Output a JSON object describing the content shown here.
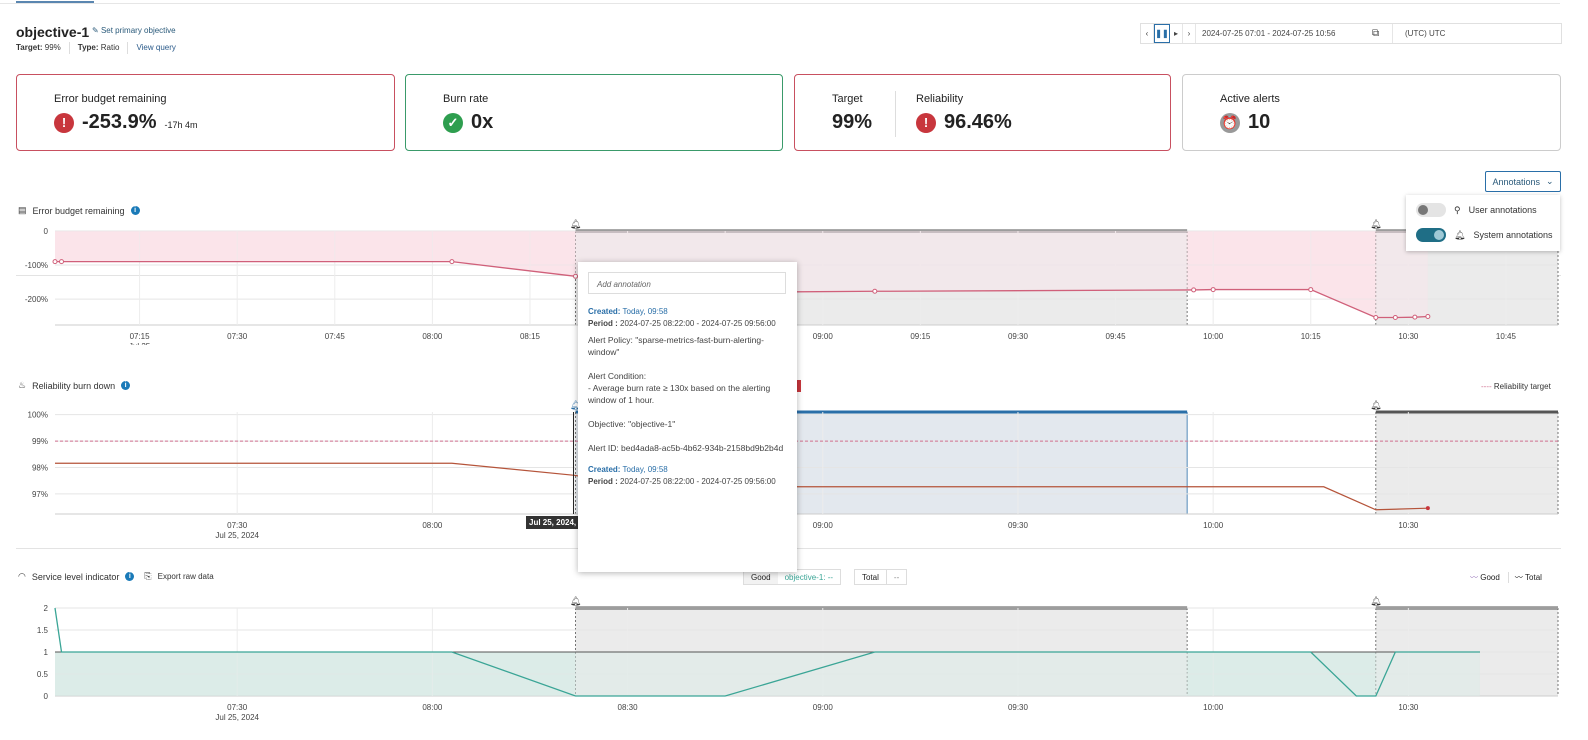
{
  "header": {
    "title": "objective-1",
    "set_primary": "Set primary objective",
    "target_label": "Target:",
    "target_value": "99%",
    "type_label": "Type:",
    "type_value": "Ratio",
    "view_query": "View query"
  },
  "timebar": {
    "range": "2024-07-25 07:01 - 2024-07-25 10:56",
    "timezone": "(UTC) UTC"
  },
  "cards": {
    "error_budget": {
      "label": "Error budget remaining",
      "value": "-253.9%",
      "sub": "-17h 4m",
      "icon": "error-icon"
    },
    "burn_rate": {
      "label": "Burn rate",
      "value": "0x",
      "icon": "check-badge-icon"
    },
    "target": {
      "label": "Target",
      "value": "99%"
    },
    "reliability": {
      "label": "Reliability",
      "value": "96.46%",
      "icon": "error-icon"
    },
    "alerts": {
      "label": "Active alerts",
      "value": "10",
      "icon": "alarm-icon"
    }
  },
  "annotations": {
    "button": "Annotations",
    "user": "User annotations",
    "user_on": false,
    "system": "System annotations",
    "system_on": true
  },
  "sections": {
    "ebr": "Error budget remaining",
    "rbd": "Reliability burn down",
    "rbd_legend": "Reliability target",
    "sli": "Service level indicator",
    "export": "Export raw data",
    "good": "Good",
    "good_val": "objective-1: --",
    "total": "Total",
    "total_val": "--",
    "legend_good": "Good",
    "legend_total": "Total"
  },
  "crosshair_label": "Jul 25, 2024,",
  "popup": {
    "placeholder": "Add annotation",
    "created_label": "Created:",
    "created": "Today, 09:58",
    "period_label": "Period :",
    "period": "2024-07-25 08:22:00 - 2024-07-25 09:56:00",
    "policy": "Alert Policy: \"sparse-metrics-fast-burn-alerting-window\"",
    "condition_title": "Alert Condition:",
    "condition": " - Average burn rate ≥ 130x based on the alerting window of 1 hour.",
    "objective": "Objective: \"objective-1\"",
    "alert_id": "Alert ID: bed4ada8-ac5b-4b62-934b-2158bd9b2b4d"
  },
  "colors": {
    "error": "#c8363d",
    "ok": "#2e9e4f",
    "ebr_line": "#d0607a",
    "ebr_fill": "#fbe4ea",
    "rel_line": "#b5543a",
    "target_line": "#d07090",
    "sli_line": "#3aa596",
    "sli_fill": "#dcece8",
    "alert_fill": "#d9d9d9",
    "selected": "#2a6fa8"
  },
  "chart_data": [
    {
      "type": "line",
      "title": "Error budget remaining",
      "y_ticks": [
        "0",
        "-100%",
        "-200%"
      ],
      "ylim": [
        -276,
        0
      ],
      "x_ticks": [
        "07:15",
        "07:30",
        "07:45",
        "08:00",
        "08:15",
        "08:30",
        "08:45",
        "09:00",
        "09:15",
        "09:30",
        "09:45",
        "10:00",
        "10:15",
        "10:30",
        "10:45"
      ],
      "x_sub": "Jul 25",
      "alerts": [
        [
          "08:22",
          "09:56"
        ],
        [
          "10:25",
          "10:53"
        ]
      ],
      "x": [
        "07:02",
        "07:03",
        "08:03",
        "08:22",
        "08:45",
        "09:08",
        "09:57",
        "10:00",
        "10:15",
        "10:25",
        "10:28",
        "10:31",
        "10:33"
      ],
      "y": [
        -90,
        -90,
        -90,
        -133,
        -180,
        -177,
        -173,
        -172,
        -172,
        -254,
        -254,
        -253,
        -251
      ]
    },
    {
      "type": "line",
      "title": "Reliability burn down",
      "y_ticks": [
        "100%",
        "99%",
        "98%",
        "97%"
      ],
      "ylim": [
        96.24,
        100.1
      ],
      "target": 99,
      "x_ticks": [
        "07:30",
        "08:00",
        "08:30",
        "09:00",
        "09:30",
        "10:00",
        "10:30"
      ],
      "x_sub": "Jul 25, 2024",
      "alerts": [
        [
          "08:22",
          "09:56"
        ],
        [
          "10:25",
          "10:53"
        ]
      ],
      "x": [
        "07:02",
        "08:03",
        "08:22",
        "08:30",
        "10:17",
        "10:25",
        "10:33"
      ],
      "y": [
        98.16,
        98.16,
        97.7,
        97.27,
        97.27,
        96.4,
        96.46
      ]
    },
    {
      "type": "area",
      "title": "Service level indicator",
      "y_ticks": [
        "2",
        "1.5",
        "1",
        "0.5",
        "0"
      ],
      "ylim": [
        0,
        2
      ],
      "x_ticks": [
        "07:30",
        "08:00",
        "08:30",
        "09:00",
        "09:30",
        "10:00",
        "10:30"
      ],
      "x_sub": "Jul 25, 2024",
      "alerts": [
        [
          "08:22",
          "09:56"
        ],
        [
          "10:25",
          "10:53"
        ]
      ],
      "series": [
        {
          "name": "Good",
          "x": [
            "07:02",
            "07:03",
            "08:03",
            "08:22",
            "08:45",
            "09:08",
            "10:15",
            "10:22",
            "10:25",
            "10:28",
            "10:41"
          ],
          "y": [
            2,
            1,
            1,
            0,
            0,
            1,
            1,
            0,
            0,
            1,
            1
          ]
        },
        {
          "name": "Total",
          "x": [
            "07:02",
            "10:41"
          ],
          "y": [
            1,
            1
          ]
        }
      ]
    }
  ]
}
